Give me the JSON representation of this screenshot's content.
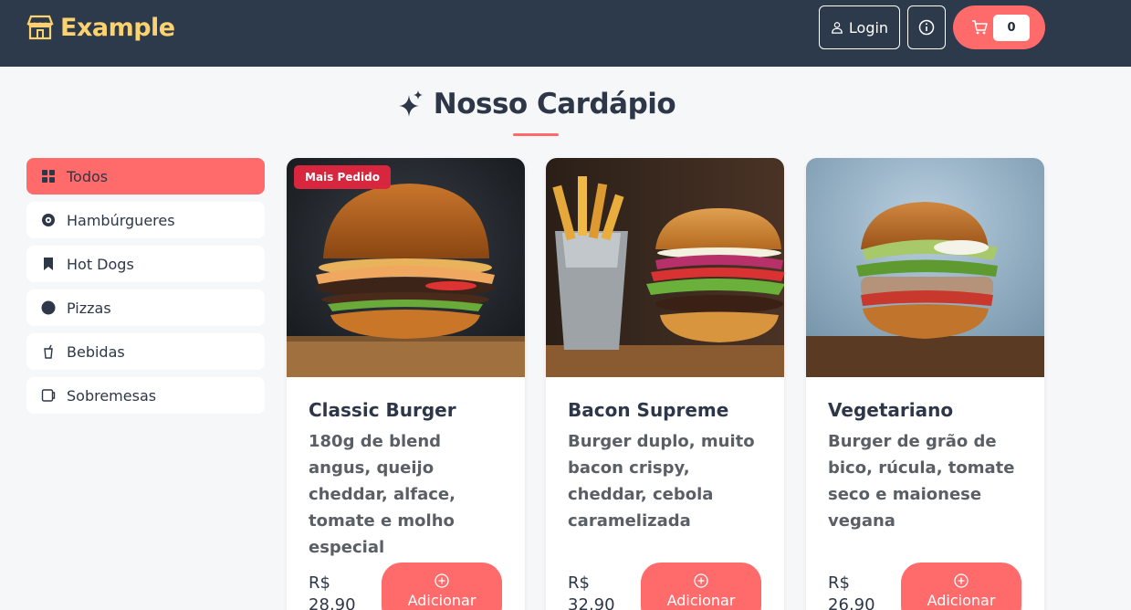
{
  "header": {
    "brand": "Example",
    "login_label": "Login",
    "cart_count": "0"
  },
  "menu": {
    "title": "Nosso Cardápio"
  },
  "categories": [
    {
      "label": "Todos",
      "icon": "grid-icon",
      "active": true
    },
    {
      "label": "Hambúrgueres",
      "icon": "burger-icon",
      "active": false
    },
    {
      "label": "Hot Dogs",
      "icon": "bookmark-icon",
      "active": false
    },
    {
      "label": "Pizzas",
      "icon": "circle-icon",
      "active": false
    },
    {
      "label": "Bebidas",
      "icon": "cup-icon",
      "active": false
    },
    {
      "label": "Sobremesas",
      "icon": "dessert-icon",
      "active": false
    }
  ],
  "products": [
    {
      "name": "Classic Burger",
      "description": "180g de blend angus, queijo cheddar, alface, tomate e molho especial",
      "price_label": "R$ 28,90",
      "badge": "Mais Pedido",
      "add_label": "Adicionar"
    },
    {
      "name": "Bacon Supreme",
      "description": "Burger duplo, muito bacon crispy, cheddar, cebola caramelizada",
      "price_label": "R$ 32,90",
      "badge": "",
      "add_label": "Adicionar"
    },
    {
      "name": "Vegetariano",
      "description": "Burger de grão de bico, rúcula, tomate seco e maionese vegana",
      "price_label": "R$ 26,90",
      "badge": "",
      "add_label": "Adicionar"
    }
  ],
  "colors": {
    "header_bg": "#2d3a4b",
    "brand": "#fcd26e",
    "accent": "#ff6b6b",
    "badge": "#d7263d"
  }
}
